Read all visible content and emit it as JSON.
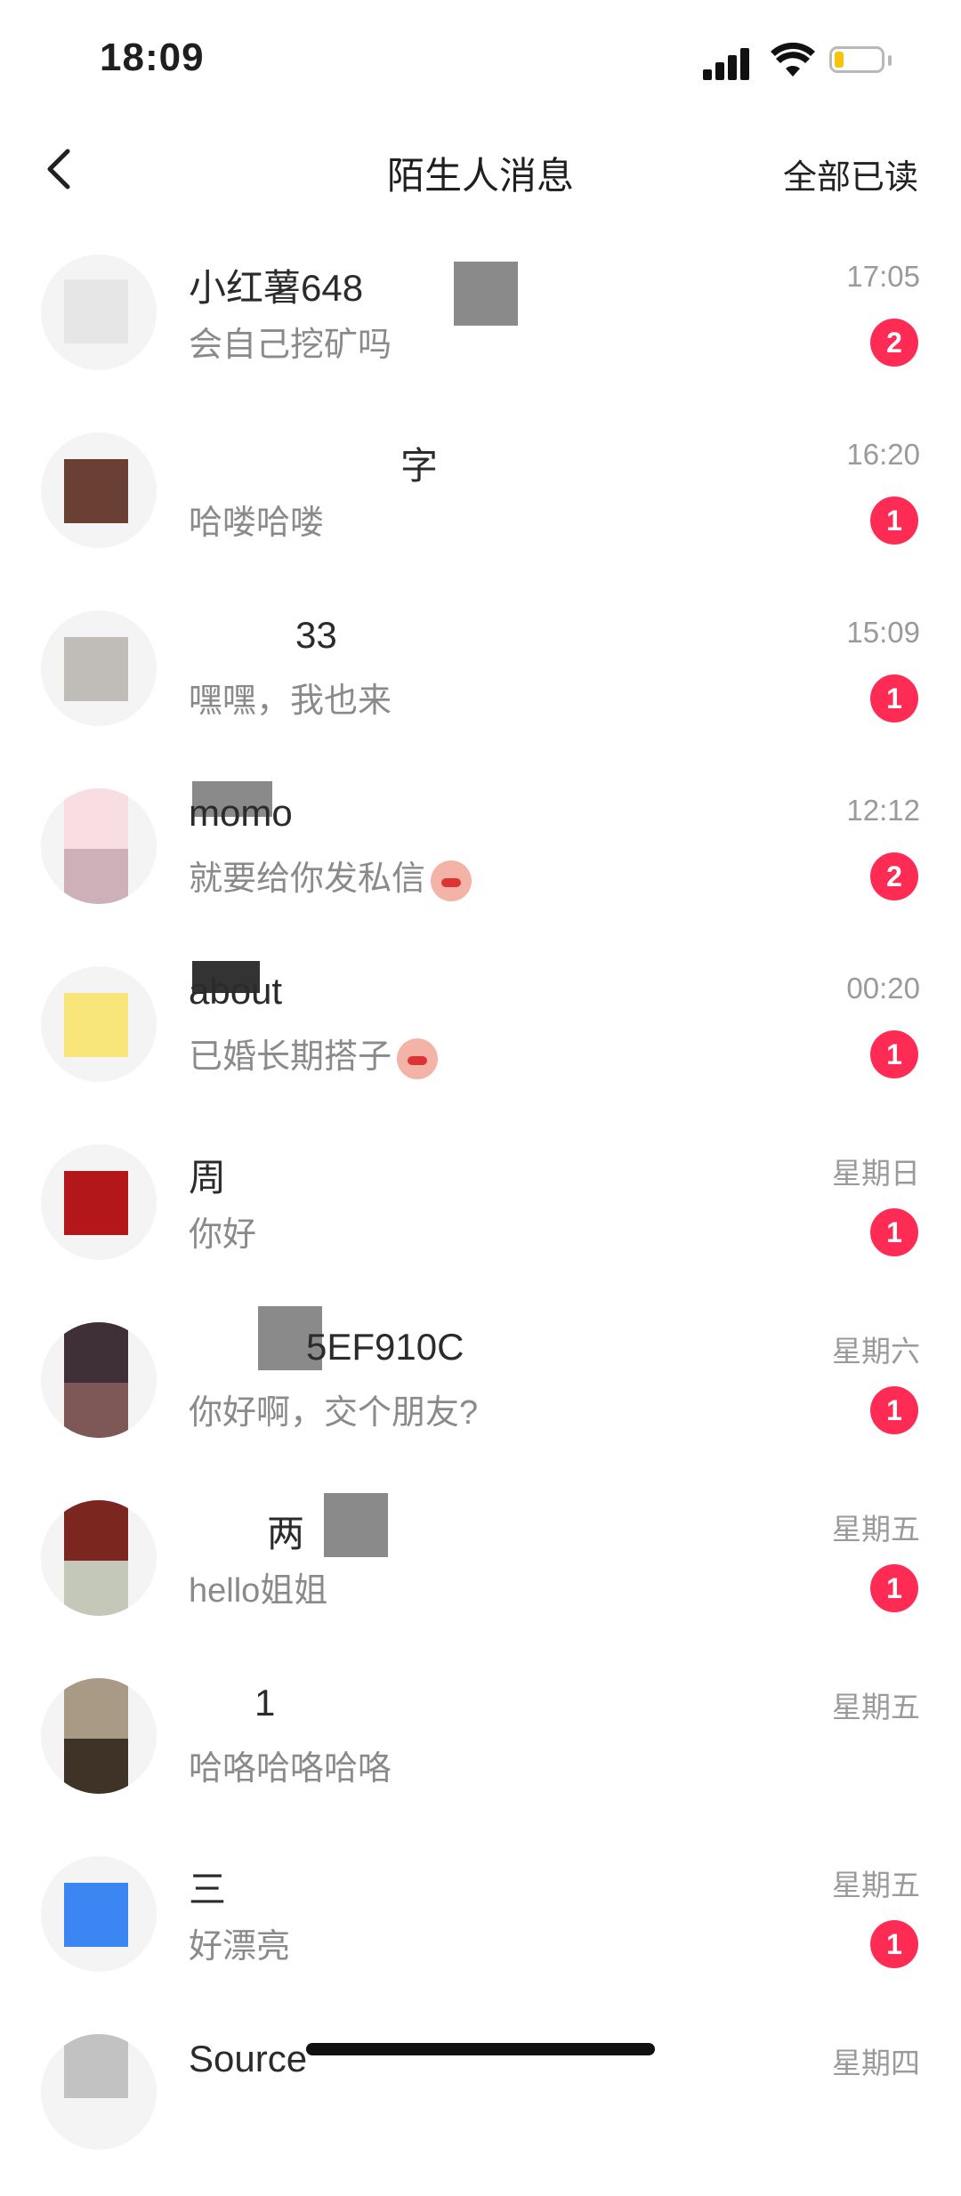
{
  "status_bar": {
    "time": "18:09",
    "battery_level": 0.2
  },
  "nav": {
    "title": "陌生人消息",
    "mark_all_read": "全部已读"
  },
  "messages": [
    {
      "name": "小红薯648",
      "preview": "会自己挖矿吗",
      "time": "17:05",
      "unread": "2",
      "avatar_colors": [
        "#e6e6e6",
        "#bdbdbd"
      ]
    },
    {
      "name": "字",
      "preview": "哈喽哈喽",
      "time": "16:20",
      "unread": "1",
      "avatar_colors": [
        "#6a4034",
        "#6a4034"
      ]
    },
    {
      "name": "33",
      "preview": "嘿嘿，我也来",
      "time": "15:09",
      "unread": "1",
      "avatar_colors": [
        "#c0bdb8",
        "#c0bdb8"
      ]
    },
    {
      "name": "momo",
      "preview": "就要给你发私信",
      "time": "12:12",
      "unread": "2",
      "avatar_colors": [
        "#f8dde2",
        "#cdb0b8"
      ]
    },
    {
      "name": "about",
      "preview": "已婚长期搭子",
      "time": "00:20",
      "unread": "1",
      "avatar_colors": [
        "#f8e57a",
        "#f8e57a"
      ]
    },
    {
      "name": "周",
      "preview": "你好",
      "time": "星期日",
      "unread": "1",
      "avatar_colors": [
        "#b3171a",
        "#b3171a"
      ]
    },
    {
      "name": "5EF910C",
      "preview": "你好啊，交个朋友?",
      "time": "星期六",
      "unread": "1",
      "avatar_colors": [
        "#3f3038",
        "#7e5757"
      ]
    },
    {
      "name": "两",
      "preview": "hello姐姐",
      "time": "星期五",
      "unread": "1",
      "avatar_colors": [
        "#7c2620",
        "#c4c8b8"
      ]
    },
    {
      "name": "1",
      "preview": "哈咯哈咯哈咯",
      "time": "星期五",
      "unread": "",
      "avatar_colors": [
        "#a99a86",
        "#3f3226"
      ]
    },
    {
      "name": "三",
      "preview": "好漂亮",
      "time": "星期五",
      "unread": "1",
      "avatar_colors": [
        "#3b86f3",
        "#3b86f3"
      ]
    },
    {
      "name": "Source",
      "preview": "",
      "time": "星期四",
      "unread": "",
      "avatar_colors": [
        "#c2c2c2",
        "#333333"
      ]
    }
  ]
}
